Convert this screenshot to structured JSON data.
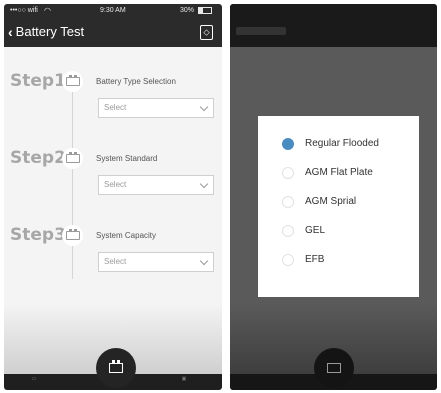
{
  "left_screen": {
    "status": {
      "carrier": "•••○○ wifi",
      "time": "9:30 AM",
      "battery_text": "30%",
      "battery_level": 0.3
    },
    "nav": {
      "back_label": "Battery Test"
    },
    "steps": [
      {
        "label": "Step1",
        "title": "Battery Type Selection",
        "placeholder": "Select"
      },
      {
        "label": "Step2",
        "title": "System Standard",
        "placeholder": "Select"
      },
      {
        "label": "Step3",
        "title": "System Capacity",
        "placeholder": "Select"
      }
    ]
  },
  "right_screen": {
    "options": [
      {
        "label": "Regular Flooded",
        "selected": true
      },
      {
        "label": "AGM Flat Plate",
        "selected": false
      },
      {
        "label": "AGM Sprial",
        "selected": false
      },
      {
        "label": "GEL",
        "selected": false
      },
      {
        "label": "EFB",
        "selected": false
      }
    ]
  },
  "colors": {
    "accent": "#4a8bc2",
    "nav_bg": "#2b2b2b",
    "step_gray": "#a7a7a7"
  }
}
